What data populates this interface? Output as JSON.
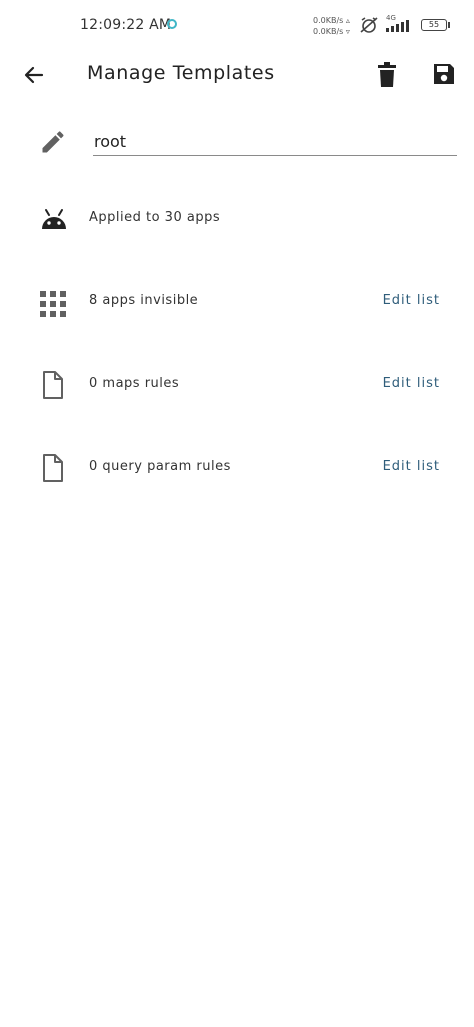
{
  "status_bar": {
    "time": "12:09:22 AM",
    "net_up": "0.0KB/s",
    "net_down": "0.0KB/s",
    "network_type": "4G",
    "battery": "55"
  },
  "app_bar": {
    "title": "Manage Templates",
    "back_icon": "arrow-left-icon",
    "delete_icon": "trash-icon",
    "save_icon": "floppy-disk-icon"
  },
  "template": {
    "name_value": "root",
    "name_icon": "pencil-icon"
  },
  "rows": [
    {
      "icon": "android-icon",
      "label": "Applied to 30 apps",
      "action": ""
    },
    {
      "icon": "grid-icon",
      "label": "8 apps invisible",
      "action": "Edit list"
    },
    {
      "icon": "file-icon",
      "label": "0 maps rules",
      "action": "Edit list"
    },
    {
      "icon": "file-icon",
      "label": "0 query param rules",
      "action": "Edit list"
    }
  ],
  "colors": {
    "accent": "#2f5d7a",
    "icon": "#616161",
    "status_dot": "#3fb6c6"
  }
}
